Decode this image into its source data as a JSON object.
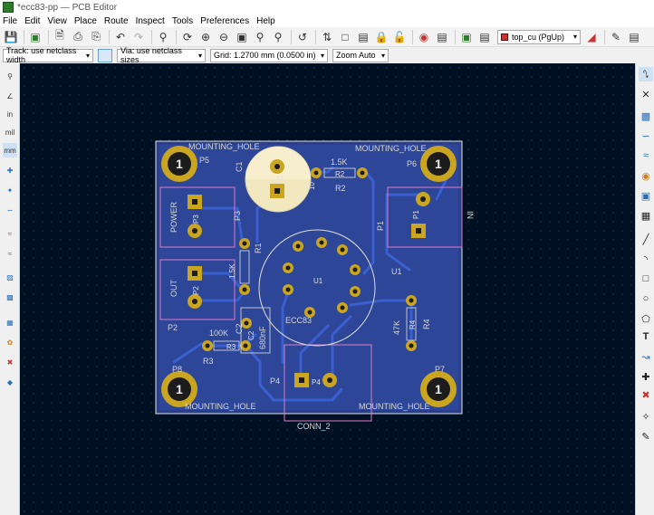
{
  "window": {
    "title": "*ecc83-pp — PCB Editor"
  },
  "menu": [
    "File",
    "Edit",
    "View",
    "Place",
    "Route",
    "Inspect",
    "Tools",
    "Preferences",
    "Help"
  ],
  "toolbar": {
    "layer": {
      "value": "top_cu (PgUp)",
      "color": "#c83434"
    }
  },
  "toolbar2": {
    "track": "Track: use netclass width",
    "via": "Via: use netclass sizes",
    "grid": "Grid: 1.2700 mm (0.0500 in)",
    "zoom": "Zoom Auto"
  },
  "left_toolbar": {
    "units_in": "in",
    "units_mil": "mil",
    "units_mm": "mm"
  },
  "board": {
    "labels": {
      "mh_top_left": "MOUNTING_HOLE",
      "mh_top_right": "MOUNTING_HOLE",
      "mh_bottom_left": "MOUNTING_HOLE",
      "mh_bottom_right": "MOUNTING_HOLE",
      "p5": "P5",
      "p6": "P6",
      "p7": "P7",
      "p8": "P8",
      "c1": "C1",
      "c1_pad": "C",
      "r2_val": "1.5K",
      "r2_a": "R2",
      "r2_b": "R2",
      "ten": "10",
      "power": "POWER",
      "p3": "P3",
      "p3_pad": "P3",
      "r1": "R1",
      "r1_val": "1.5K",
      "p1": "P1",
      "p1_pad": "P1",
      "in_label": "IN",
      "out": "OUT",
      "p2_pad": "P2",
      "p2": "P2",
      "u1": "U1",
      "u1_pad": "U1",
      "ecc83": "ECC83",
      "r4_val": "47K",
      "r4_a": "R4",
      "r4_b": "R4",
      "r3_val": "100K",
      "r3_a": "R3",
      "r3_b": "R3",
      "c2": "C2",
      "c2_b": "C2",
      "c2_val": "680nF",
      "p4": "P4",
      "p4_pad": "P4",
      "conn2": "CONN_2",
      "hole": "1"
    }
  }
}
